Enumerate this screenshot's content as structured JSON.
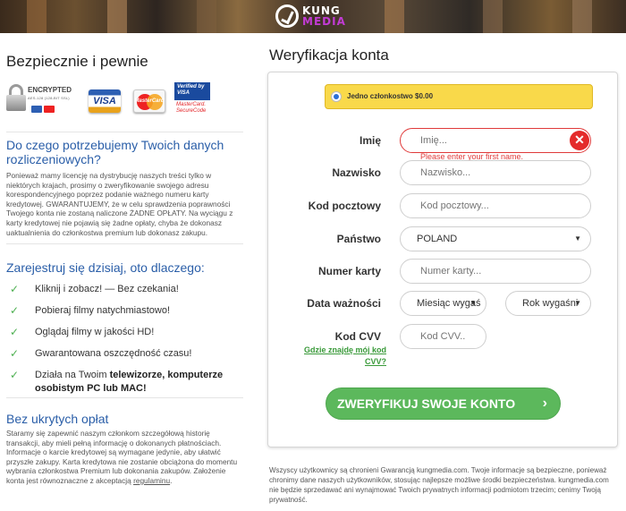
{
  "header": {
    "logo_line1": "KUNG",
    "logo_line2": "MEDIA"
  },
  "left": {
    "title": "Bezpiecznie i pewnie",
    "badges": {
      "encrypted": "ENCRYPTED",
      "encrypted_sub": "AES-128 (128-BIT SSL)",
      "visa": "VISA",
      "mastercard": "MasterCard",
      "verified_by_visa": "Verified by VISA",
      "mastercard_securecode": "MasterCard. SecureCode"
    },
    "why_heading": "Do czego potrzebujemy Twoich danych rozliczeniowych?",
    "why_text": "Ponieważ mamy licencję na dystrybucję naszych treści tylko w niektórych krajach, prosimy o zweryfikowanie swojego adresu korespondencyjnego poprzez podanie ważnego numeru karty kredytowej. GWARANTUJEMY, że w celu sprawdzenia poprawności Twojego konta nie zostaną naliczone ŻADNE OPŁATY. Na wyciągu z karty kredytowej nie pojawią się żadne opłaty, chyba że dokonasz uaktualnienia do członkostwa premium lub dokonasz zakupu.",
    "register_heading": "Zarejestruj się dzisiaj, oto dlaczego:",
    "benefits": [
      {
        "text": "Kliknij i zobacz! — Bez czekania!"
      },
      {
        "text": "Pobieraj filmy natychmiastowo!"
      },
      {
        "text": "Oglądaj filmy w jakości HD!"
      },
      {
        "text": "Gwarantowana oszczędność czasu!"
      },
      {
        "text_pre": "Działa na Twoim ",
        "text_bold": "telewizorze, komputerze osobistym PC lub MAC!"
      }
    ],
    "fees_heading": "Bez ukrytych opłat",
    "fees_text": "Staramy się zapewnić naszym członkom szczegółową historię transakcji, aby mieli pełną informację o dokonanych płatnościach. Informacje o karcie kredytowej są wymagane jedynie, aby ułatwić przyszłe zakupy. Karta kredytowa nie zostanie obciążona do momentu wybrania członkostwa Premium lub dokonania zakupów. Założenie konta jest równoznaczne z akceptacją ",
    "fees_link": "regulaminu",
    "fees_end": "."
  },
  "form": {
    "title": "Weryfikacja konta",
    "plan_label": "Jedno członkostwo $0.00",
    "first_name": {
      "label": "Imię",
      "placeholder": "Imię...",
      "error": "Please enter your first name."
    },
    "last_name": {
      "label": "Nazwisko",
      "placeholder": "Nazwisko..."
    },
    "postal": {
      "label": "Kod pocztowy",
      "placeholder": "Kod pocztowy..."
    },
    "country": {
      "label": "Państwo",
      "value": "POLAND"
    },
    "card": {
      "label": "Numer karty",
      "placeholder": "Numer karty..."
    },
    "expiry": {
      "label": "Data ważności",
      "month": "Miesiąc wygaś",
      "year": "Rok wygaśni"
    },
    "cvv": {
      "label": "Kod CVV",
      "placeholder": "Kod CVV...",
      "help": "Gdzie znajdę mój kod CVV?"
    },
    "submit": "ZWERYFIKUJ SWOJE KONTO",
    "submit_arrow": "›"
  },
  "footer_note": "Wszyscy użytkownicy są chronieni Gwarancją kungmedia.com. Twoje informacje są bezpieczne, ponieważ chronimy dane naszych użytkowników, stosując najlepsze możliwe środki bezpieczeństwa. kungmedia.com nie będzie sprzedawać ani wynajmować Twoich prywatnych informacji podmiotom trzecim; cenimy Twoją prywatność.",
  "colors": {
    "accent_blue": "#2a5ea8",
    "success_green": "#5cb85c",
    "error_red": "#e03a3a",
    "plan_yellow": "#f9d94a"
  }
}
